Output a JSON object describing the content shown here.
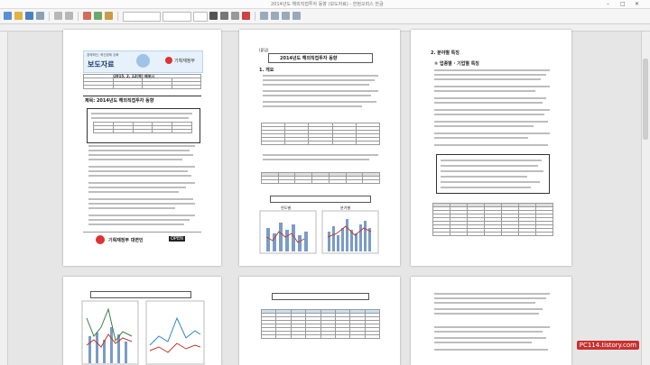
{
  "window": {
    "title": "2014년도 해외직접투자 동향 (보도자료) - 한컴오피스 한글"
  },
  "page1": {
    "banner_tagline": "경제혁신, 혁신경제 강화",
    "report_label": "보도자료",
    "report_date": "2015. 2. 12(목) 배포시",
    "ministry_name": "기획재정부",
    "heading": "제목: 2014년도 해외직접투자 동향",
    "bottom_org": "기획재정부 대변인",
    "open_badge": "OPEN"
  },
  "page2": {
    "tag": "(붙임)",
    "title": "2014년도 해외직접투자 동향",
    "section": "1. 개요",
    "chart_left": "연도별",
    "chart_right": "분기별"
  },
  "page3": {
    "section": "2. 분야별 특징",
    "subsection": "① 업종별 · 기업별 특징"
  },
  "watermark": "PC114.tistory.com"
}
